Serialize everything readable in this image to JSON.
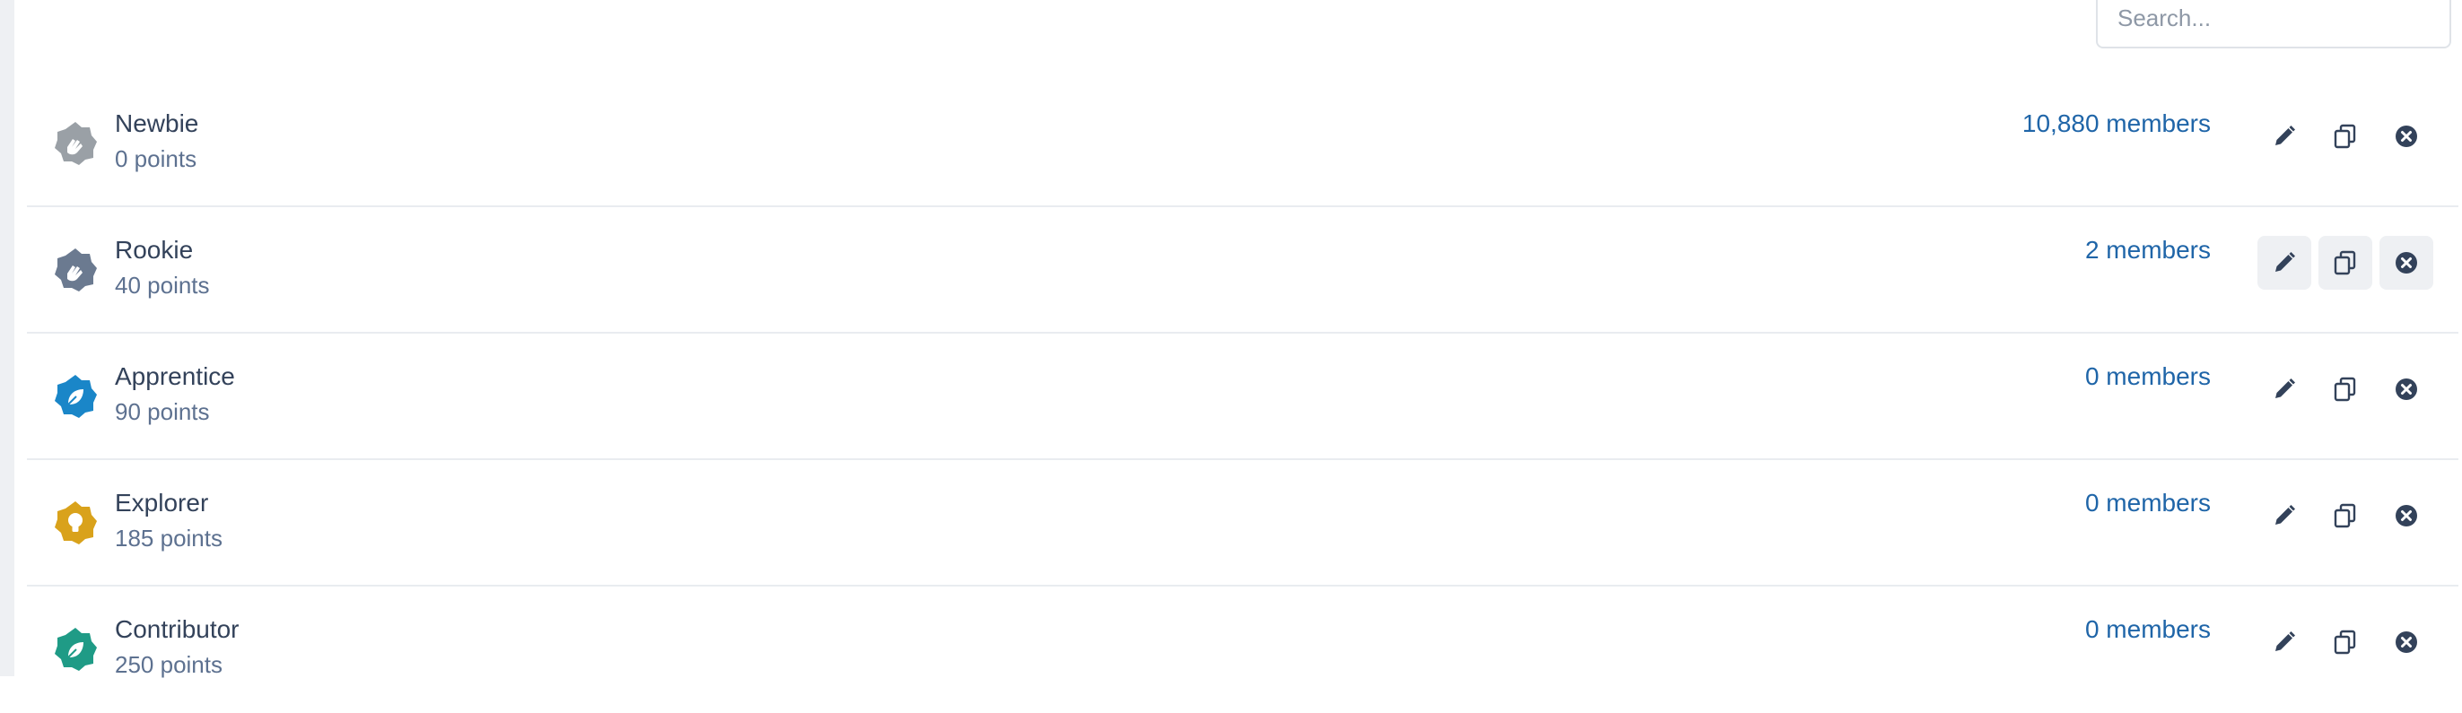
{
  "search": {
    "placeholder": "Search..."
  },
  "levels": [
    {
      "name": "Newbie",
      "points": "0 points",
      "members": "10,880 members",
      "badge_color": "#9aa0a6",
      "badge_icon": "hand-icon"
    },
    {
      "name": "Rookie",
      "points": "40 points",
      "members": "2 members",
      "badge_color": "#6b7a90",
      "badge_icon": "hand-icon"
    },
    {
      "name": "Apprentice",
      "points": "90 points",
      "members": "0 members",
      "badge_color": "#1a86c8",
      "badge_icon": "leaf-icon"
    },
    {
      "name": "Explorer",
      "points": "185 points",
      "members": "0 members",
      "badge_color": "#d9a21b",
      "badge_icon": "lightbulb-icon"
    },
    {
      "name": "Contributor",
      "points": "250 points",
      "members": "0 members",
      "badge_color": "#1f9b86",
      "badge_icon": "leaf-icon"
    }
  ],
  "colors": {
    "link": "#1f65a8",
    "text": "#33425a",
    "muted": "#5d7190",
    "action_icon": "#33425a"
  }
}
